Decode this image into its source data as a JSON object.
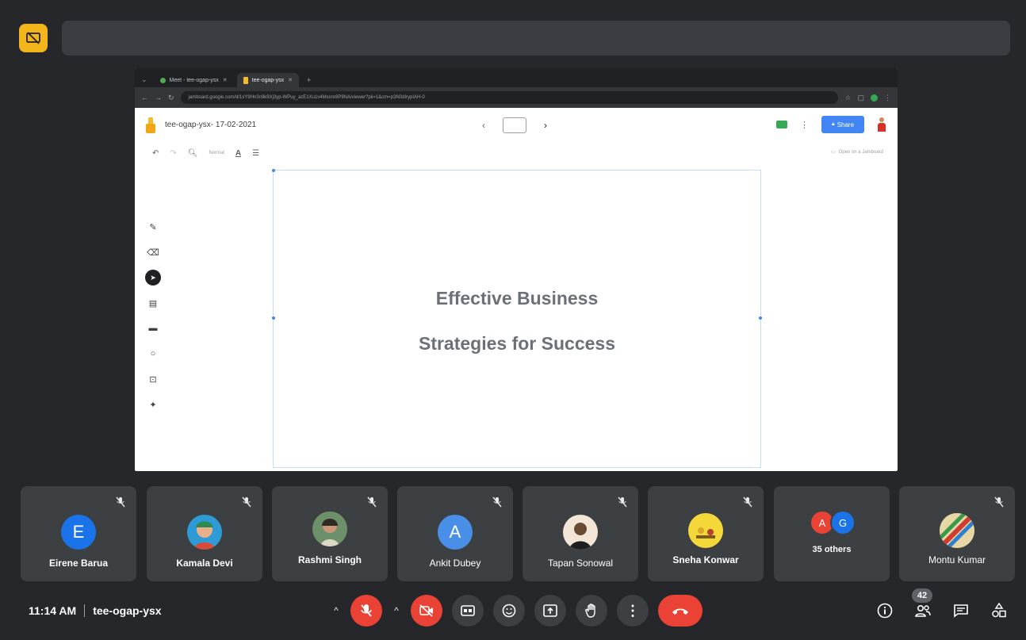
{
  "browser": {
    "tabs": [
      {
        "label": "Meet - tee-ogap-ysx"
      },
      {
        "label": "tee-ogap-ysx"
      }
    ],
    "url": "jamboard.google.com/d/1xY9Hn3n9k9Xj3yp-WPuy_azE1Xu1v4Mxxnr8P9NA/viewer?pli=1&cm=p3N0dIrypIAH-0"
  },
  "jamboard": {
    "title": "tee-ogap-ysx- 17-02-2021",
    "share_label": "Share",
    "zoom_label": "Normal",
    "open_label": "Open on a Jamboard",
    "slide_lines": [
      "Effective Business",
      "Strategies for Success"
    ]
  },
  "participants": [
    {
      "name": "Eirene Barua",
      "initial": "E",
      "avatar_color": "#1a73e8"
    },
    {
      "name": "Kamala Devi",
      "initial": "",
      "avatar_color": "#2e9bd6"
    },
    {
      "name": "Rashmi Singh",
      "initial": "",
      "avatar_color": "#6d8f6a"
    },
    {
      "name": "Ankit Dubey",
      "initial": "A",
      "avatar_color": "#4a8fe7"
    },
    {
      "name": "Tapan Sonowal",
      "initial": "",
      "avatar_color": "#f3e6d6"
    },
    {
      "name": "Sneha Konwar",
      "initial": "",
      "avatar_color": "#f4d83a"
    },
    {
      "name": "Montu Kumar",
      "initial": "",
      "avatar_color": "#c8a35b"
    }
  ],
  "others": {
    "label": "35 others",
    "initials": [
      "A",
      "G"
    ],
    "colors": [
      "#ea4335",
      "#1a73e8"
    ]
  },
  "meeting": {
    "time": "11:14 AM",
    "code": "tee-ogap-ysx",
    "participant_count": "42"
  },
  "colors": {
    "accent": "#f2b51c",
    "danger": "#ea4335",
    "tile": "#3c4043"
  }
}
